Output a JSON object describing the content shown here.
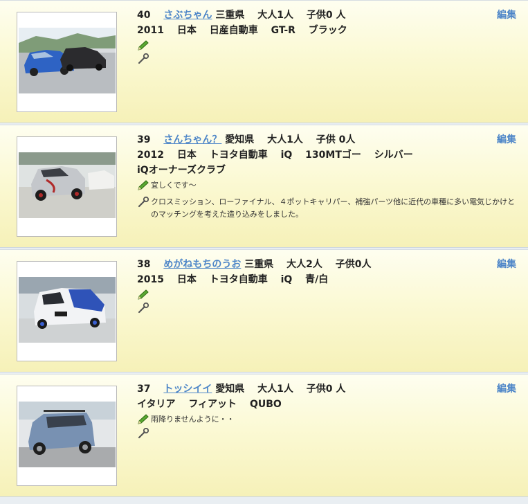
{
  "entries": [
    {
      "number": "40",
      "user_name": "さぶちゃん",
      "prefecture": "三重県",
      "adults": "大人1人",
      "children": "子供0 人",
      "year": "2011",
      "country": "日本",
      "maker": "日産自動車",
      "model": "GT-R",
      "extra1": "",
      "color": "ブラック",
      "club": "",
      "comment": "",
      "customization": "",
      "edit_label": "編集"
    },
    {
      "number": "39",
      "user_name": "さんちゃん？",
      "prefecture": "愛知県",
      "adults": "大人1人",
      "children": "子供 0人",
      "year": "2012",
      "country": "日本",
      "maker": "トヨタ自動車",
      "model": "iQ",
      "extra1": "130MTゴー",
      "color": "シルバー",
      "club": "iQオーナーズクラブ",
      "comment": "宜しくです〜",
      "customization": "クロスミッション、ローファイナル、４ポットキャリパー、補強パーツ他に近代の車種に多い電気じかけとのマッチングを考えた造り込みをしました。",
      "edit_label": "編集"
    },
    {
      "number": "38",
      "user_name": "めがねもちのうお",
      "prefecture": "三重県",
      "adults": "大人2人",
      "children": "子供0人",
      "year": "2015",
      "country": "日本",
      "maker": "トヨタ自動車",
      "model": "iQ",
      "extra1": "",
      "color": "青/白",
      "club": "",
      "comment": "",
      "customization": "",
      "edit_label": "編集"
    },
    {
      "number": "37",
      "user_name": "トッシイイ",
      "prefecture": "愛知県",
      "adults": "大人1人",
      "children": "子供0 人",
      "year": "",
      "country": "イタリア",
      "maker": "フィアット",
      "model": "QUBO",
      "extra1": "",
      "color": "",
      "club": "",
      "comment": "雨降りませんように・・",
      "customization": "",
      "edit_label": "編集"
    }
  ],
  "icons": {
    "comment": "pencil-icon",
    "customization": "wrench-icon"
  },
  "colors": {
    "link": "#4e86c8",
    "card_top": "#fefef0",
    "card_bottom": "#f6f1b8"
  }
}
